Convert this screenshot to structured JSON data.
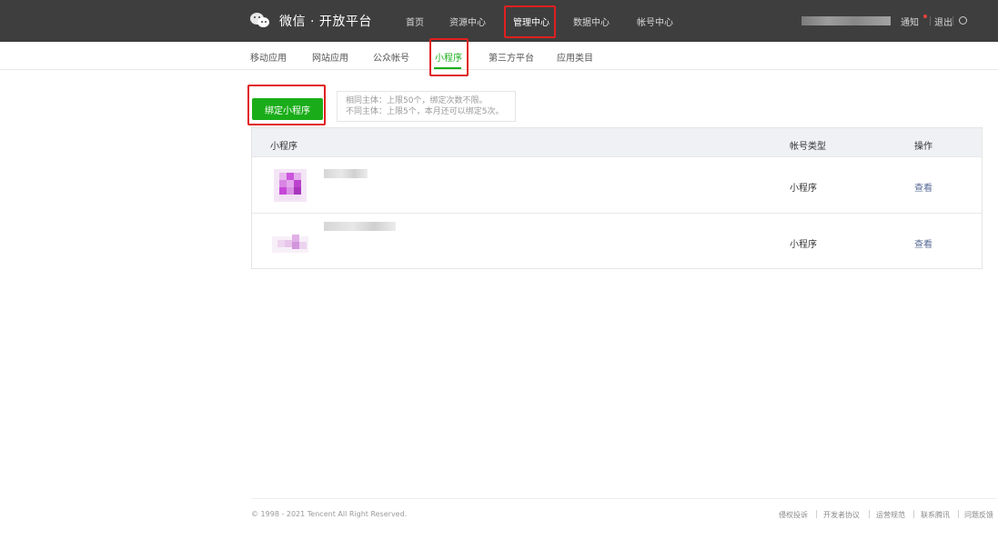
{
  "header": {
    "logo_text": "微信 · 开放平台",
    "nav": [
      "首页",
      "资源中心",
      "管理中心",
      "数据中心",
      "帐号中心"
    ],
    "active_nav": "管理中心",
    "notice_label": "通知",
    "logout_label": "退出",
    "lang_label": "简"
  },
  "subnav": {
    "items": [
      "移动应用",
      "网站应用",
      "公众帐号",
      "小程序",
      "第三方平台",
      "应用类目"
    ],
    "active": "小程序"
  },
  "bind": {
    "button_label": "绑定小程序",
    "tip_line1": "相同主体：上限50个，绑定次数不限。",
    "tip_line2": "不同主体：上限5个，本月还可以绑定5次。"
  },
  "table": {
    "headers": [
      "小程序",
      "帐号类型",
      "操作"
    ],
    "rows": [
      {
        "type": "小程序",
        "action": "查看"
      },
      {
        "type": "小程序",
        "action": "查看"
      }
    ]
  },
  "footer": {
    "copyright": "© 1998 - 2021 Tencent All Right Reserved.",
    "links": [
      "侵权投诉",
      "开发者协议",
      "运营规范",
      "联系腾讯",
      "问题反馈"
    ]
  },
  "colors": {
    "topbar": "#3e3e3e",
    "accent_green": "#1aad19",
    "link_blue": "#576b95",
    "highlight_red": "#e02020"
  }
}
